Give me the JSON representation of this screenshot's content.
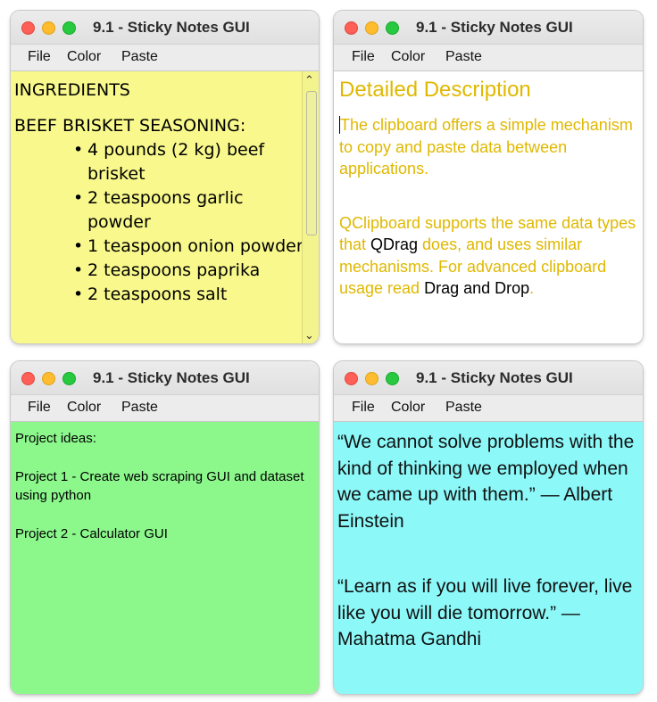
{
  "windows": [
    {
      "title": "9.1 - Sticky Notes GUI",
      "menu": [
        "File",
        "Color",
        "Paste"
      ],
      "note_color": "#f8f88c",
      "content": {
        "heading": "INGREDIENTS",
        "subheading": "BEEF BRISKET SEASONING:",
        "bullets": [
          "4 pounds (2 kg) beef brisket",
          "2 teaspoons garlic powder",
          "1 teaspoon onion powder",
          "2 teaspoons paprika",
          "2 teaspoons salt"
        ]
      }
    },
    {
      "title": "9.1 - Sticky Notes GUI",
      "menu": [
        "File",
        "Color",
        "Paste"
      ],
      "note_color": "#ffffff",
      "text_color": "#e0b800",
      "content": {
        "heading": "Detailed Description",
        "para1": "The clipboard offers a simple mechanism to copy and paste data between applications.",
        "para2_parts": [
          "QClipboard supports the same data types that ",
          "QDrag",
          " does, and uses similar mechanisms. For advanced clipboard usage read ",
          "Drag and Drop",
          "."
        ]
      }
    },
    {
      "title": "9.1 - Sticky Notes GUI",
      "menu": [
        "File",
        "Color",
        "Paste"
      ],
      "note_color": "#8cf88c",
      "content": {
        "line1": "Project ideas:",
        "line2": "Project 1 - Create web scraping GUI and dataset using python",
        "line3": "Project 2 - Calculator GUI"
      }
    },
    {
      "title": "9.1 - Sticky Notes GUI",
      "menu": [
        "File",
        "Color",
        "Paste"
      ],
      "note_color": "#8cf8f8",
      "content": {
        "quote1": "“We cannot solve problems with the kind of thinking we employed when we came up with them.” — Albert Einstein",
        "quote2": "“Learn as if you will live forever, live like you will die tomorrow.” — Mahatma Gandhi"
      }
    }
  ]
}
